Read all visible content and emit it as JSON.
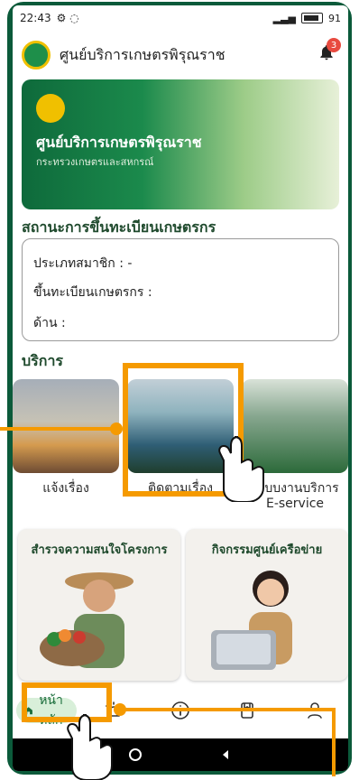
{
  "status_bar": {
    "time": "22:43",
    "battery": "91"
  },
  "header": {
    "title": "ศูนย์บริการเกษตรพิรุณราช",
    "notification_count": "3"
  },
  "hero": {
    "title": "ศูนย์บริการเกษตรพิรุณราช",
    "subtitle": "กระทรวงเกษตรและสหกรณ์"
  },
  "registration": {
    "title": "สถานะการขึ้นทะเบียนเกษตรกร",
    "rows": [
      "ประเภทสมาชิก : -",
      "ขึ้นทะเบียนเกษตรกร :",
      "ด้าน :"
    ]
  },
  "services": {
    "title": "บริการ",
    "items": [
      {
        "label": "แจ้งเรื่อง"
      },
      {
        "label": "ติดตามเรื่อง"
      },
      {
        "label": "ระบบงานบริการ",
        "label2": "E-service"
      }
    ]
  },
  "promos": [
    {
      "title": "สำรวจความสนใจโครงการ"
    },
    {
      "title": "กิจกรรมศูนย์เครือข่าย"
    }
  ],
  "bottom_nav": {
    "home_label": "หน้าหลัก"
  },
  "colors": {
    "accent": "#f59a00",
    "brand": "#0b5a3a",
    "green": "#1a6d3b"
  }
}
